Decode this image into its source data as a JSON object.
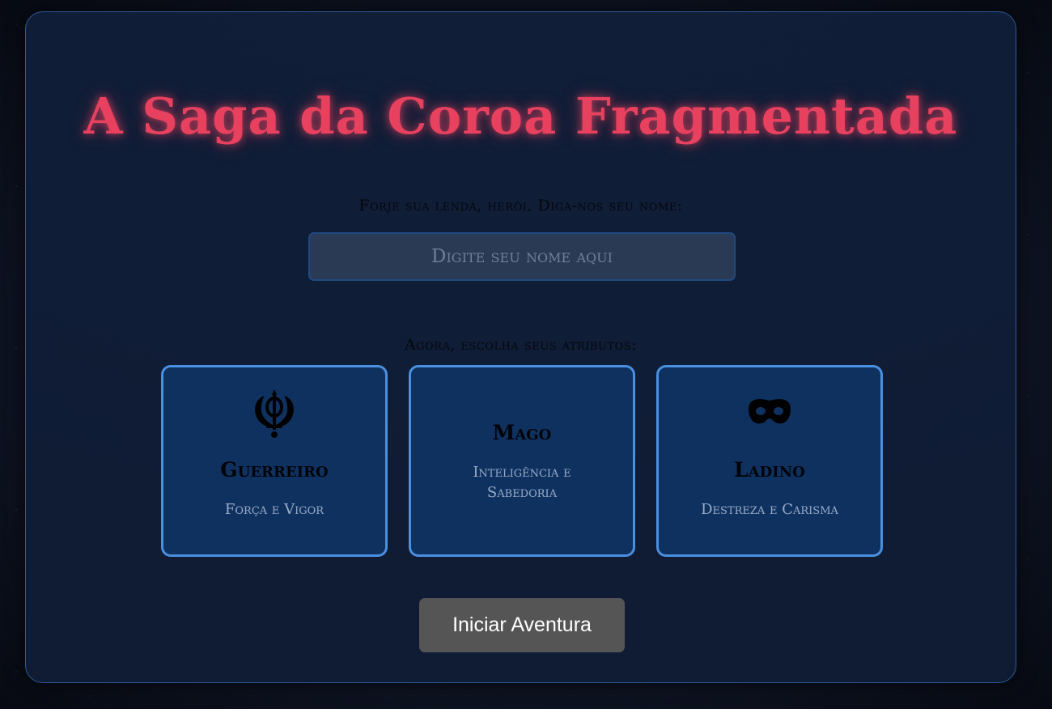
{
  "title": "A Saga da Coroa Fragmentada",
  "name_prompt": "Forje sua lenda, herói. Diga-nos seu nome:",
  "name_input": {
    "placeholder": "Digite seu nome aqui",
    "value": ""
  },
  "attributes_prompt": "Agora, escolha seus atributos:",
  "classes": [
    {
      "name": "Guerreiro",
      "description": "Força e Vigor",
      "icon": "khanda-icon"
    },
    {
      "name": "Mago",
      "description": "Inteligência e Sabedoria",
      "icon": ""
    },
    {
      "name": "Ladino",
      "description": "Destreza e Carisma",
      "icon": "mask-icon"
    }
  ],
  "start_button": "Iniciar Aventura",
  "colors": {
    "title": "#e8415f",
    "panel_border": "#2d5a96",
    "card_border": "#4a8fe0",
    "card_bg": "#0f3160",
    "button_bg": "#555555"
  }
}
